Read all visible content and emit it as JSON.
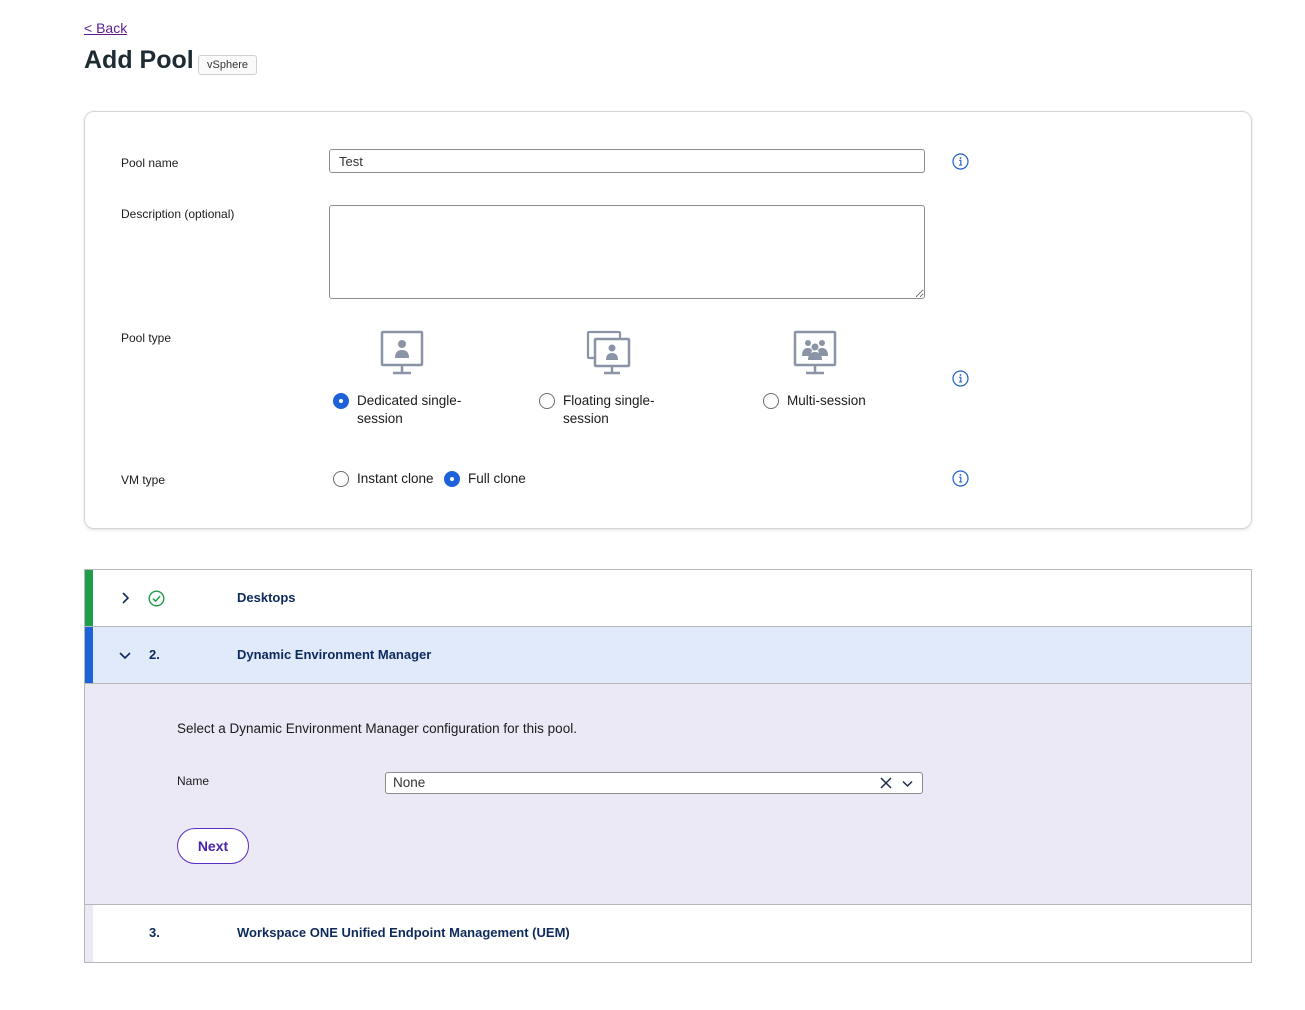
{
  "header": {
    "back_label": "< Back",
    "title": "Add Pool",
    "badge": "vSphere"
  },
  "form": {
    "pool_name_label": "Pool name",
    "pool_name_value": "Test",
    "description_label": "Description (optional)",
    "description_value": "",
    "pool_type_label": "Pool type",
    "pool_types": [
      {
        "label_line1": "Dedicated single-",
        "label_line2": "session",
        "icon": "dedicated-desktop-icon",
        "selected": true
      },
      {
        "label_line1": "Floating single-",
        "label_line2": "session",
        "icon": "floating-desktop-icon",
        "selected": false
      },
      {
        "label_line1": "Multi-session",
        "label_line2": "",
        "icon": "multi-session-icon",
        "selected": false
      }
    ],
    "vm_type_label": "VM type",
    "vm_types": [
      {
        "label": "Instant clone",
        "selected": false
      },
      {
        "label": "Full clone",
        "selected": true
      }
    ]
  },
  "accordion": {
    "sections": [
      {
        "step": "",
        "status_icon": "check-circle-icon",
        "title": "Desktops",
        "expanded": false,
        "stripe_color": "#1e9e4a"
      },
      {
        "step": "2.",
        "status_icon": "",
        "title": "Dynamic Environment Manager",
        "expanded": true,
        "stripe_color": "#1d62d8"
      },
      {
        "step": "3.",
        "status_icon": "",
        "title": "Workspace ONE Unified Endpoint Management (UEM)",
        "expanded": false,
        "stripe_color": "#ebe9f6"
      }
    ],
    "dem": {
      "description": "Select a Dynamic Environment Manager configuration for this pool.",
      "name_label": "Name",
      "name_value": "None",
      "next_label": "Next"
    }
  },
  "colors": {
    "accent_blue": "#1d62d8",
    "success_green": "#1e9e4a",
    "header_text": "#0d2a5c",
    "button_purple": "#4b22a8"
  }
}
